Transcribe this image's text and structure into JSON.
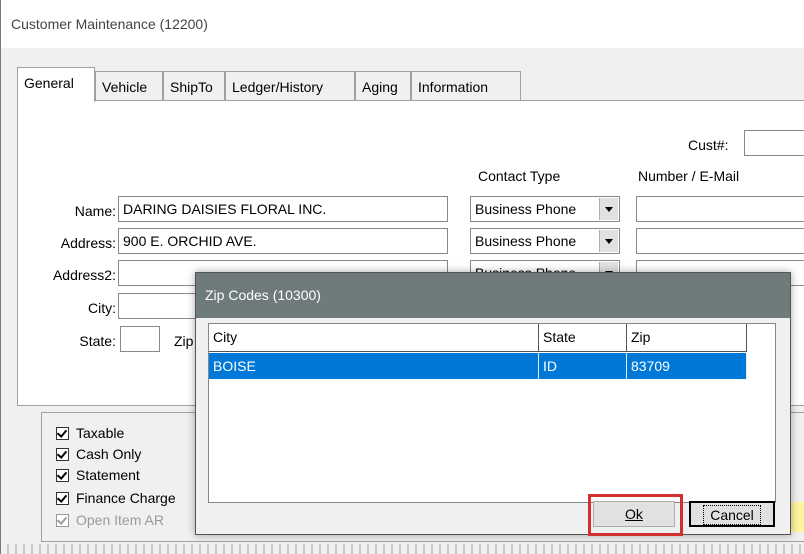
{
  "window": {
    "title": "Customer Maintenance (12200)"
  },
  "tabs": [
    {
      "label": "General"
    },
    {
      "label": "Vehicle"
    },
    {
      "label": "ShipTo"
    },
    {
      "label": "Ledger/History"
    },
    {
      "label": "Aging"
    },
    {
      "label": "Information"
    }
  ],
  "form": {
    "cust_num_label": "Cust#:",
    "contact_type_header": "Contact Type",
    "number_email_header": "Number / E-Mail",
    "name_label": "Name:",
    "name_value": "DARING DAISIES FLORAL INC.",
    "address_label": "Address:",
    "address_value": "900 E. ORCHID AVE.",
    "address2_label": "Address2:",
    "city_label": "City:",
    "state_label": "State:",
    "zip_label": "Zip",
    "contact_types": [
      "Business Phone",
      "Business Phone",
      "Business Phone"
    ]
  },
  "checkboxes": [
    {
      "label": "Taxable",
      "checked": true,
      "enabled": true
    },
    {
      "label": "Cash Only",
      "checked": true,
      "enabled": true
    },
    {
      "label": "Statement",
      "checked": true,
      "enabled": true
    },
    {
      "label": "Finance Charge",
      "checked": true,
      "enabled": true
    },
    {
      "label": "Open Item AR",
      "checked": true,
      "enabled": false
    }
  ],
  "dialog": {
    "title": "Zip Codes (10300)",
    "columns": [
      "City",
      "State",
      "Zip"
    ],
    "rows": [
      [
        "BOISE",
        "ID",
        "83709"
      ]
    ],
    "ok_label": "Ok",
    "cancel_label": "Cancel"
  },
  "colors": {
    "selection": "#0078d7",
    "dialog_title_bg": "#6e7b7a",
    "highlight_border": "#d32f2f"
  }
}
